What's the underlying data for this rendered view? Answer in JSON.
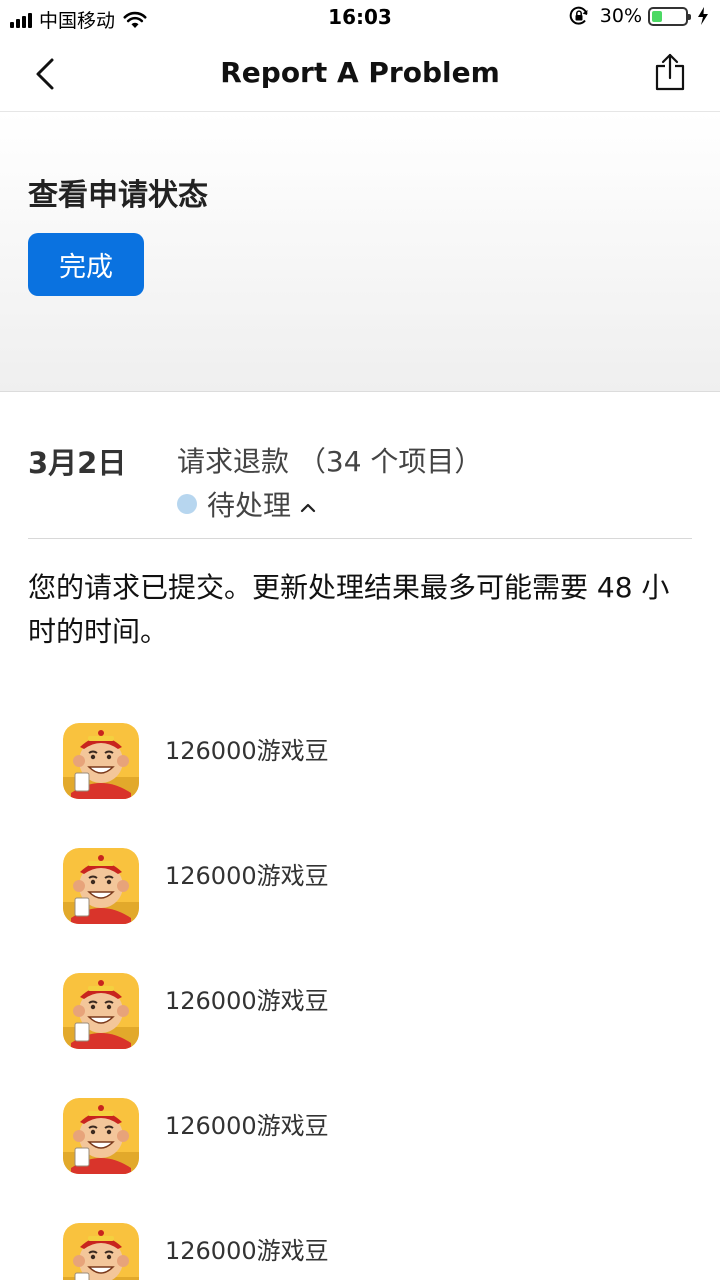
{
  "status_bar": {
    "carrier": "中国移动",
    "time": "16:03",
    "battery": "30%",
    "battery_level": 0.3,
    "icons": [
      "signal-icon",
      "wifi-icon",
      "rotation-lock-icon",
      "battery-icon",
      "charging-icon"
    ]
  },
  "nav": {
    "title": "Report A Problem",
    "icons": [
      "back-chevron-icon",
      "share-icon"
    ]
  },
  "panel": {
    "title": "查看申请状态",
    "done_label": "完成"
  },
  "request": {
    "date": "3月2日",
    "title": "请求退款 （34 个项目）",
    "status": "待处理",
    "note": "您的请求已提交。更新处理结果最多可能需要 48 小时的时间。"
  },
  "items": [
    {
      "label": "126000游戏豆"
    },
    {
      "label": "126000游戏豆"
    },
    {
      "label": "126000游戏豆"
    },
    {
      "label": "126000游戏豆"
    },
    {
      "label": "126000游戏豆"
    }
  ],
  "colors": {
    "accent": "#0a72e0",
    "status_dot": "#b7d6ef",
    "battery_fill": "#4cd964"
  }
}
